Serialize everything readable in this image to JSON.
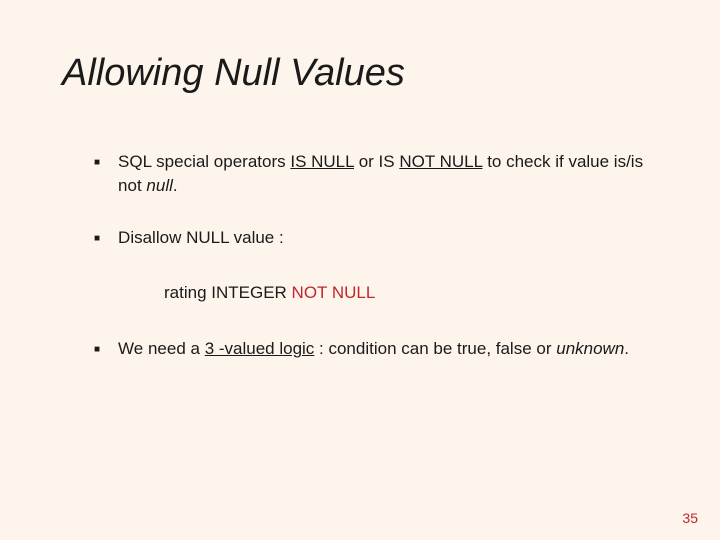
{
  "title": "Allowing Null Values",
  "bullets": {
    "b1": {
      "pre": "SQL special operators ",
      "u1": "IS NULL",
      "mid": " or  IS ",
      "u2": "NOT NULL",
      "post1": " to check if value is/is not ",
      "null_word": "null",
      "period": "."
    },
    "b2": "Disallow NULL value :",
    "code": {
      "black": "rating  INTEGER  ",
      "red": "NOT NULL"
    },
    "b3": {
      "pre": "We need a ",
      "u": "3 -valued logic",
      "mid": "  : condition can be true, false or  ",
      "unk": "unknown",
      "period": "."
    }
  },
  "page_number": "35"
}
